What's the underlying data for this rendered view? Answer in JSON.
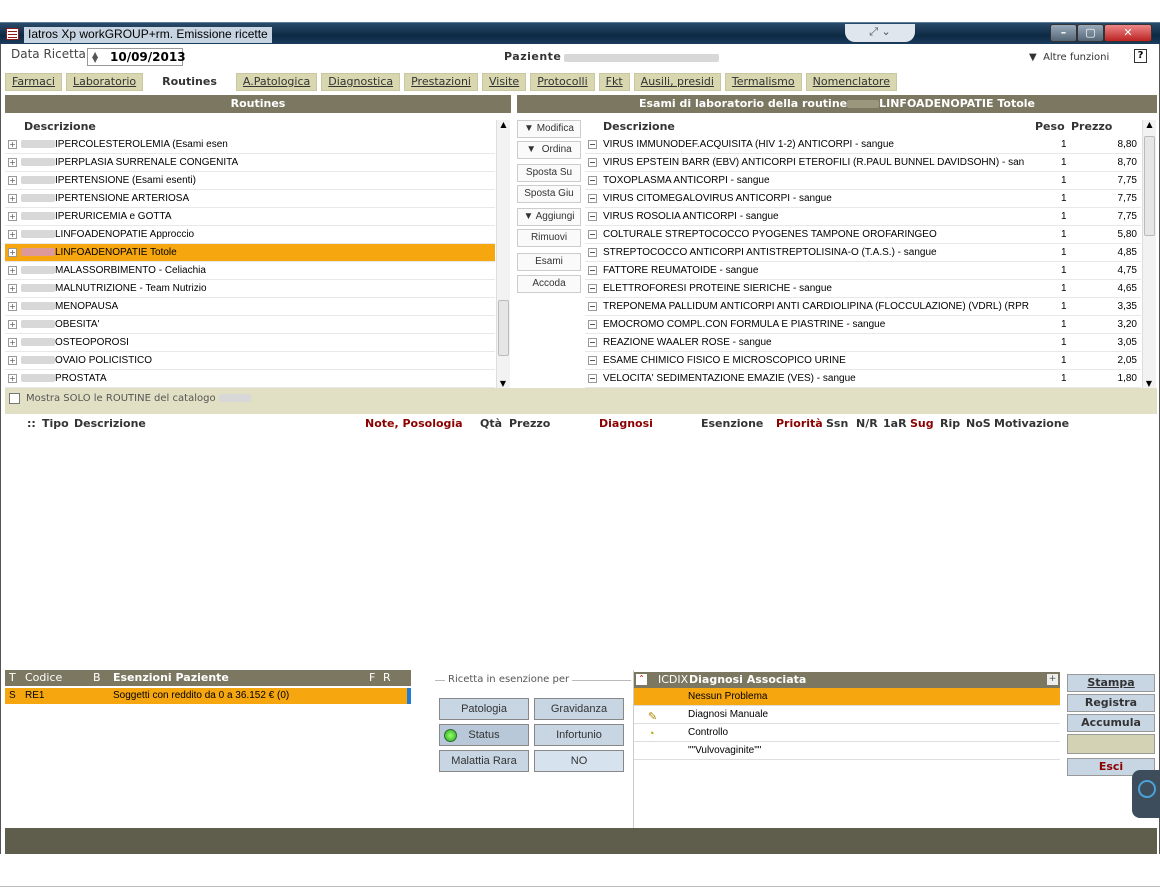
{
  "window": {
    "title": "Iatros Xp workGROUP+rm. Emissione ricette"
  },
  "header": {
    "data_label": "Data Ricetta",
    "date_value": "10/09/2013",
    "paziente_label": "Paziente",
    "altre_funzioni": "Altre funzioni",
    "help": "?"
  },
  "tabs": [
    "Farmaci",
    "Laboratorio",
    "Routines",
    "A.Patologica",
    "Diagnostica",
    "Prestazioni",
    "Visite",
    "Protocolli",
    "Fkt",
    "Ausili, presidi",
    "Termalismo",
    "Nomenclatore"
  ],
  "routines": {
    "title": "Routines",
    "col_desc": "Descrizione",
    "items": [
      "IPERCOLESTEROLEMIA (Esami esen",
      "IPERPLASIA SURRENALE CONGENITA",
      "IPERTENSIONE (Esami esenti)",
      "IPERTENSIONE ARTERIOSA",
      "IPERURICEMIA e GOTTA",
      "LINFOADENOPATIE Approccio",
      "LINFOADENOPATIE Totole",
      "MALASSORBIMENTO - Celiachia",
      "MALNUTRIZIONE - Team Nutrizio",
      "MENOPAUSA",
      "OBESITA'",
      "OSTEOPOROSI",
      "OVAIO POLICISTICO",
      "PROSTATA"
    ]
  },
  "mid_buttons": [
    "Modifica",
    "Ordina",
    "Sposta Su",
    "Sposta Giu",
    "Aggiungi",
    "Rimuovi",
    "Esami",
    "Accoda"
  ],
  "exams": {
    "title": "Esami di laboratorio della routine",
    "title_suffix": "LINFOADENOPATIE Totole",
    "col_desc": "Descrizione",
    "col_peso": "Peso",
    "col_prezzo": "Prezzo",
    "rows": [
      {
        "desc": "VIRUS IMMUNODEF.ACQUISITA (HIV 1-2) ANTICORPI - sangue",
        "peso": "1",
        "prezzo": "8,80"
      },
      {
        "desc": "VIRUS EPSTEIN BARR (EBV) ANTICORPI ETEROFILI (R.PAUL BUNNEL DAVIDSOHN) - san",
        "peso": "1",
        "prezzo": "8,70"
      },
      {
        "desc": "TOXOPLASMA ANTICORPI - sangue",
        "peso": "1",
        "prezzo": "7,75"
      },
      {
        "desc": "VIRUS CITOMEGALOVIRUS ANTICORPI - sangue",
        "peso": "1",
        "prezzo": "7,75"
      },
      {
        "desc": "VIRUS ROSOLIA ANTICORPI - sangue",
        "peso": "1",
        "prezzo": "7,75"
      },
      {
        "desc": "COLTURALE STREPTOCOCCO PYOGENES TAMPONE OROFARINGEO",
        "peso": "1",
        "prezzo": "5,80"
      },
      {
        "desc": "STREPTOCOCCO ANTICORPI ANTISTREPTOLISINA-O (T.A.S.) - sangue",
        "peso": "1",
        "prezzo": "4,85"
      },
      {
        "desc": "FATTORE REUMATOIDE - sangue",
        "peso": "1",
        "prezzo": "4,75"
      },
      {
        "desc": "ELETTROFORESI PROTEINE SIERICHE - sangue",
        "peso": "1",
        "prezzo": "4,65"
      },
      {
        "desc": "TREPONEMA PALLIDUM ANTICORPI ANTI CARDIOLIPINA (FLOCCULAZIONE) (VDRL) (RPR",
        "peso": "1",
        "prezzo": "3,35"
      },
      {
        "desc": "EMOCROMO COMPL.CON FORMULA E PIASTRINE - sangue",
        "peso": "1",
        "prezzo": "3,20"
      },
      {
        "desc": "REAZIONE WAALER ROSE - sangue",
        "peso": "1",
        "prezzo": "3,05"
      },
      {
        "desc": "ESAME CHIMICO FISICO E MICROSCOPICO URINE",
        "peso": "1",
        "prezzo": "2,05"
      },
      {
        "desc": "VELOCITA' SEDIMENTAZIONE EMAZIE (VES) - sangue",
        "peso": "1",
        "prezzo": "1,80"
      }
    ]
  },
  "mostra_solo": "Mostra SOLO le ROUTINE del catalogo",
  "rx_headers": {
    "sep": "::",
    "tipo": "Tipo",
    "descrizione": "Descrizione",
    "note": "Note, Posologia",
    "qta": "Qtà",
    "prezzo": "Prezzo",
    "diagnosi": "Diagnosi",
    "esenzione": "Esenzione",
    "priorita": "Priorità",
    "ssn": "Ssn",
    "nr": "N/R",
    "ar": "1aR",
    "sug": "Sug",
    "rip": "Rip",
    "nos": "NoS",
    "motivazione": "Motivazione"
  },
  "esenzioni": {
    "h_t": "T",
    "h_codice": "Codice",
    "h_b": "B",
    "h_title": "Esenzioni Paziente",
    "h_f": "F",
    "h_r": "R",
    "row": {
      "t": "S",
      "codice": "RE1",
      "desc": "Soggetti con reddito da 0 a 36.152 € (0)"
    }
  },
  "ricetta": {
    "legend": "Ricetta in esenzione per",
    "buttons": [
      "Patologia",
      "Gravidanza",
      "Status",
      "Infortunio",
      "Malattia Rara",
      "NO"
    ]
  },
  "diagnosi": {
    "icdix": "ICDIX",
    "title": "Diagnosi Associata",
    "rows": [
      "Nessun Problema",
      "Diagnosi Manuale",
      "Controllo",
      "\"\"Vulvovaginite\"\""
    ]
  },
  "actions": [
    "Stampa",
    "Registra",
    "Accumula",
    "Esci"
  ],
  "colors": {
    "highlight": "#f6a60f",
    "header": "#7b7760",
    "tab": "#d8d7b0"
  }
}
